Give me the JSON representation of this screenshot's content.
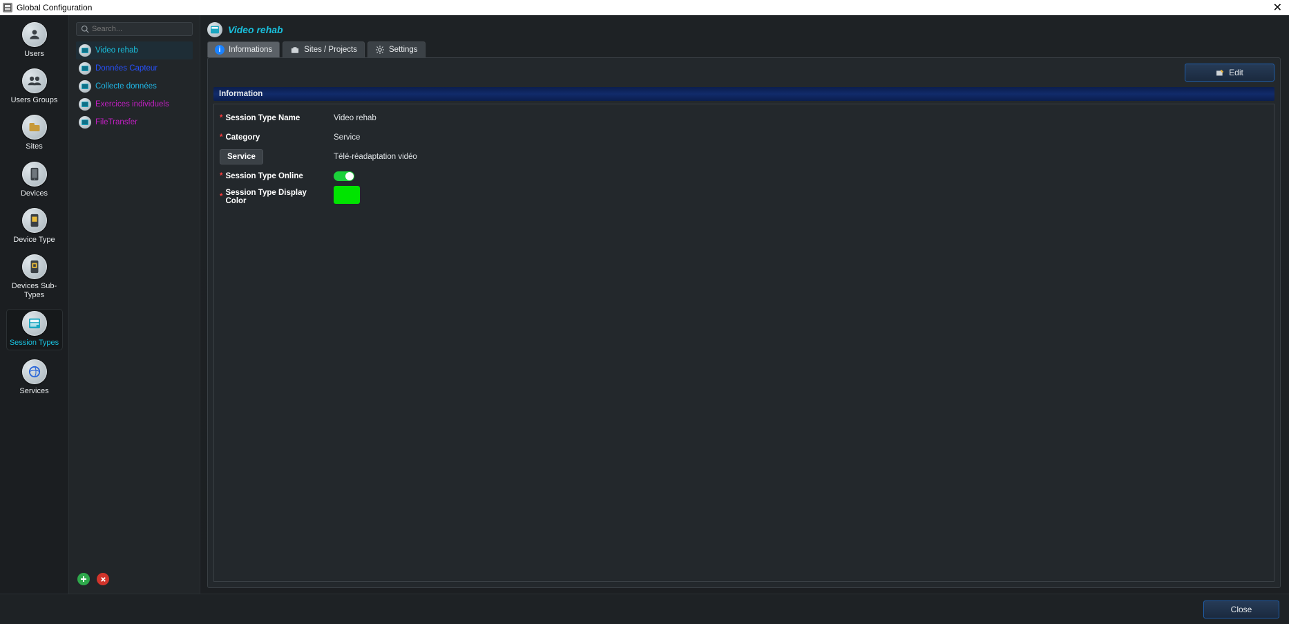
{
  "window": {
    "title": "Global Configuration"
  },
  "nav": {
    "items": [
      {
        "label": "Users"
      },
      {
        "label": "Users Groups"
      },
      {
        "label": "Sites"
      },
      {
        "label": "Devices"
      },
      {
        "label": "Device Type"
      },
      {
        "label": "Devices Sub-Types"
      },
      {
        "label": "Session Types",
        "active": true
      },
      {
        "label": "Services"
      }
    ]
  },
  "search": {
    "placeholder": "Search..."
  },
  "session_types": {
    "items": [
      {
        "label": "Video rehab",
        "color": "cyan",
        "selected": true
      },
      {
        "label": "Données Capteur",
        "color": "blue"
      },
      {
        "label": "Collecte données",
        "color": "cyan2"
      },
      {
        "label": "Exercices individuels",
        "color": "magenta"
      },
      {
        "label": "FileTransfer",
        "color": "magenta"
      }
    ]
  },
  "page": {
    "title": "Video rehab"
  },
  "tabs": [
    {
      "label": "Informations",
      "active": true,
      "icon": "info"
    },
    {
      "label": "Sites / Projects",
      "icon": "briefcase"
    },
    {
      "label": "Settings",
      "icon": "gear"
    }
  ],
  "actions": {
    "edit": "Edit",
    "close": "Close"
  },
  "info_section": {
    "heading": "Information",
    "fields": {
      "session_type_name": {
        "label": "Session Type Name",
        "value": "Video rehab"
      },
      "category": {
        "label": "Category",
        "value": "Service"
      },
      "service": {
        "chip": "Service",
        "value": "Télé-réadaptation vidéo"
      },
      "online": {
        "label": "Session Type Online",
        "value": true
      },
      "display_color": {
        "label": "Session Type Display Color",
        "value": "#00e400"
      }
    }
  }
}
